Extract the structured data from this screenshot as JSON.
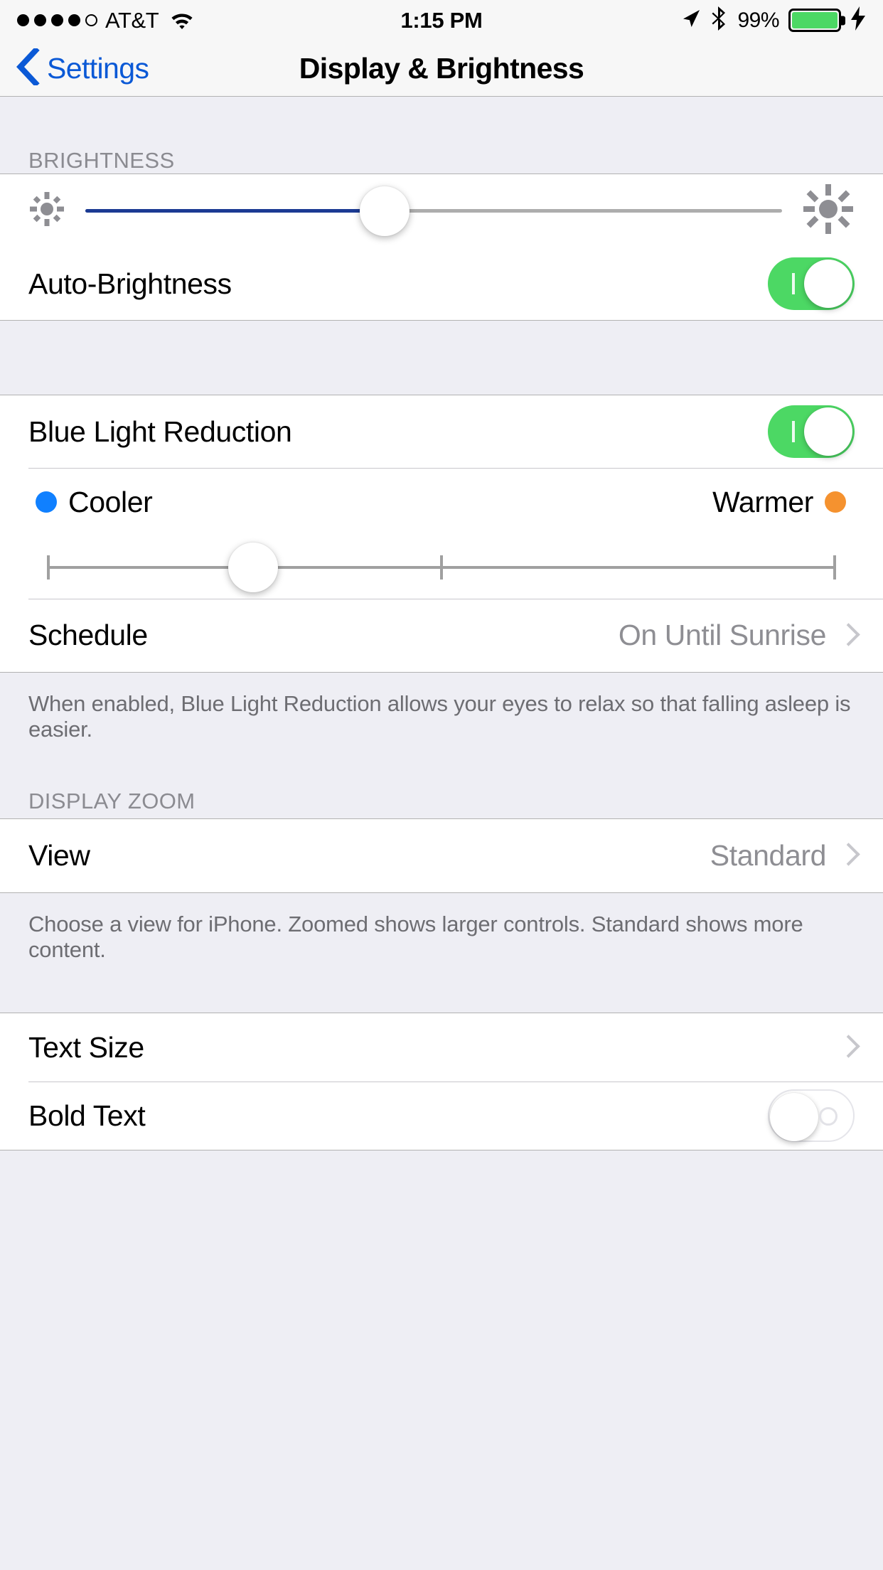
{
  "status_bar": {
    "signal_dots_filled": 4,
    "signal_dots_total": 5,
    "carrier": "AT&T",
    "wifi_icon": "wifi-icon",
    "time": "1:15 PM",
    "location_icon": "location-arrow-icon",
    "bluetooth_icon": "bluetooth-icon",
    "battery_percent": "99%",
    "battery_color": "#4cd864",
    "charging_icon": "lightning-bolt-icon"
  },
  "nav": {
    "back_label": "Settings",
    "back_icon": "chevron-left-icon",
    "title": "Display & Brightness"
  },
  "sections": {
    "brightness": {
      "header": "BRIGHTNESS",
      "slider": {
        "name": "brightness-slider",
        "value_percent": 43,
        "min_icon": "sun-small-icon",
        "max_icon": "sun-large-icon",
        "fill_color": "#1b3a93",
        "track_color": "#adadad"
      },
      "auto_brightness": {
        "label": "Auto-Brightness",
        "toggle_state": "on",
        "toggle_color": "#4cd864"
      }
    },
    "blue_light": {
      "row_label": "Blue Light Reduction",
      "toggle_state": "on",
      "toggle_color": "#4cd864",
      "cooler_label": "Cooler",
      "cooler_color": "#1080ff",
      "warmer_label": "Warmer",
      "warmer_color": "#f5922f",
      "temp_slider": {
        "name": "color-temperature-slider",
        "value_percent": 26,
        "ticks_percent": [
          0,
          50,
          100
        ]
      },
      "schedule": {
        "label": "Schedule",
        "value": "On Until Sunrise",
        "chevron": "chevron-right-icon"
      },
      "footer": "When enabled, Blue Light Reduction allows your eyes to relax so that falling asleep is easier."
    },
    "display_zoom": {
      "header": "DISPLAY ZOOM",
      "view": {
        "label": "View",
        "value": "Standard",
        "chevron": "chevron-right-icon"
      },
      "footer": "Choose a view for iPhone. Zoomed shows larger controls. Standard shows more content."
    },
    "text": {
      "text_size": {
        "label": "Text Size",
        "chevron": "chevron-right-icon"
      },
      "bold_text": {
        "label": "Bold Text",
        "toggle_state": "off"
      }
    }
  }
}
